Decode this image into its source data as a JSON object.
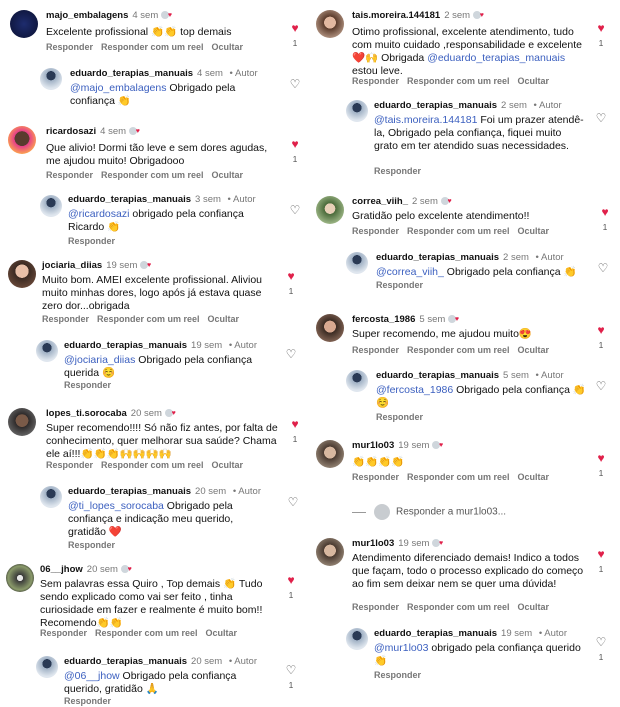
{
  "labels": {
    "reply": "Responder",
    "reply_reel": "Responder com um reel",
    "hide": "Ocultar",
    "author": "Autor"
  },
  "left": {
    "c1": {
      "user": "majo_embalagens",
      "time": "4 sem",
      "text": "Excelente profissional 👏👏 top demais",
      "count": "1"
    },
    "c1r": {
      "user": "eduardo_terapias_manuais",
      "time": "4 sem",
      "mention": "@majo_embalagens",
      "text": " Obrigado pela confiança 👏"
    },
    "c2": {
      "user": "ricardosazi",
      "time": "4 sem",
      "text": "Que alivio! Dormi tão leve e sem dores agudas, me ajudou muito! Obrigadooo",
      "count": "1"
    },
    "c2r": {
      "user": "eduardo_terapias_manuais",
      "time": "3 sem",
      "mention": "@ricardosazi",
      "text": " obrigado pela confiança Ricardo 👏"
    },
    "c3": {
      "user": "jociaria_diias",
      "time": "19 sem",
      "text": "Muito bom. AMEI excelente profissional. Aliviou muito minhas dores, logo após já estava quase zero dor...obrigada",
      "count": "1"
    },
    "c3r": {
      "user": "eduardo_terapias_manuais",
      "time": "19 sem",
      "mention": "@jociaria_diias",
      "text": " Obrigado pela confiança querida ☺️"
    },
    "c4": {
      "user": "lopes_ti.sorocaba",
      "time": "20 sem",
      "text": "Super recomendo!!!! Só não fiz antes, por falta de conhecimento, quer melhorar sua saúde? Chama ele aí!!!👏👏👏🙌🙌🙌🙌",
      "count": "1"
    },
    "c4r": {
      "user": "eduardo_terapias_manuais",
      "time": "20 sem",
      "mention": "@ti_lopes_sorocaba",
      "text": " Obrigado pela confiança e indicação meu querido, gratidão ❤️"
    },
    "c5": {
      "user": "06__jhow",
      "time": "20 sem",
      "text": "Sem palavras essa Quiro , Top demais 👏 Tudo sendo explicado como vai ser feito , tinha curiosidade em fazer e realmente é muito bom!! Recomendo👏👏",
      "count": "1"
    },
    "c5r": {
      "user": "eduardo_terapias_manuais",
      "time": "20 sem",
      "mention": "@06__jhow",
      "text": " Obrigado pela confiança querido, gratidão 🙏",
      "count": "1"
    }
  },
  "right": {
    "c1": {
      "user": "tais.moreira.144181",
      "time": "2 sem",
      "text": "Otimo profissional, excelente atendimento, tudo com muito cuidado ,responsabilidade e excelente ❤️🙌 Obrigada ",
      "mention": "@eduardo_terapias_manuais",
      "text2": " estou leve.",
      "count": "1"
    },
    "c1r": {
      "user": "eduardo_terapias_manuais",
      "time": "2 sem",
      "mention": "@tais.moreira.144181",
      "text": " Foi um prazer atendê-la, Obrigado pela confiança, fiquei muito grato em ter atendido suas necessidades."
    },
    "c2": {
      "user": "correa_viih_",
      "time": "2 sem",
      "text": "Gratidão pelo excelente atendimento!!",
      "count": "1"
    },
    "c2r": {
      "user": "eduardo_terapias_manuais",
      "time": "2 sem",
      "mention": "@correa_viih_",
      "text": " Obrigado pela confiança 👏"
    },
    "c3": {
      "user": "fercosta_1986",
      "time": "5 sem",
      "text": "Super recomendo, me ajudou muito😍",
      "count": "1"
    },
    "c3r": {
      "user": "eduardo_terapias_manuais",
      "time": "5 sem",
      "mention": "@fercosta_1986",
      "text": " Obrigado pela confiança 👏☺️"
    },
    "c4": {
      "user": "mur1lo03",
      "time": "19 sem",
      "text": "👏👏👏👏",
      "count": "1",
      "more": "Responder a mur1lo03..."
    },
    "c5": {
      "user": "mur1lo03",
      "time": "19 sem",
      "text": "Atendimento diferenciado demais! Indico a todos que façam, todo o processo explicado do começo ao fim sem deixar nem se quer uma dúvida!",
      "count": "1"
    },
    "c5r": {
      "user": "eduardo_terapias_manuais",
      "time": "19 sem",
      "mention": "@mur1lo03",
      "text": " obrigado pela confiança querido 👏",
      "count": "1"
    }
  }
}
